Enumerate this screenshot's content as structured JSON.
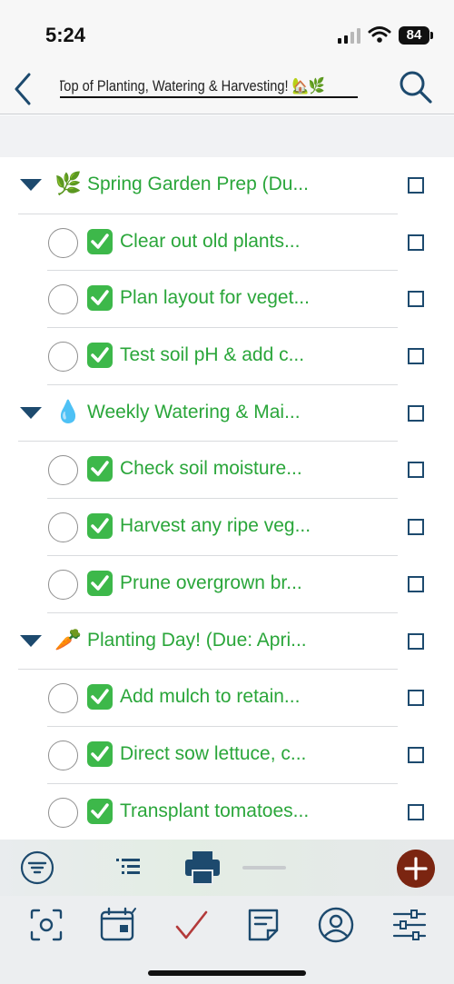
{
  "status_bar": {
    "time": "5:24",
    "battery": "84",
    "icons": [
      "cellular-signal-icon",
      "wifi-icon",
      "battery-icon"
    ]
  },
  "header": {
    "title": "Top of Planting, Watering & Harvesting! 🏡🌿",
    "back_icon": "chevron-left-icon",
    "search_icon": "search-icon"
  },
  "colors": {
    "accent": "#1d4a6e",
    "task_text": "#2aa63a",
    "add_button": "#7b2511",
    "checkmark_bg": "#3db84a"
  },
  "sections": [
    {
      "emoji": "🌿",
      "label": "Spring Garden Prep (Du...",
      "tasks": [
        {
          "label": "Clear out old plants..."
        },
        {
          "label": "Plan layout for veget..."
        },
        {
          "label": "Test soil pH & add c..."
        }
      ]
    },
    {
      "emoji": "💧",
      "label": "Weekly Watering & Mai...",
      "tasks": [
        {
          "label": "Check soil moisture..."
        },
        {
          "label": "Harvest any ripe veg..."
        },
        {
          "label": "Prune overgrown br..."
        }
      ]
    },
    {
      "emoji": "🥕",
      "label": "Planting Day! (Due: Apri...",
      "tasks": [
        {
          "label": "Add mulch to retain..."
        },
        {
          "label": "Direct sow lettuce, c..."
        },
        {
          "label": "Transplant tomatoes..."
        }
      ]
    }
  ],
  "toolbar": {
    "icons": [
      "filter-icon",
      "outline-icon",
      "print-icon",
      "add-icon"
    ]
  },
  "tabbar": {
    "icons": [
      "focus-icon",
      "calendar-icon",
      "checkmark-icon",
      "notes-icon",
      "person-icon",
      "settings-sliders-icon"
    ]
  }
}
